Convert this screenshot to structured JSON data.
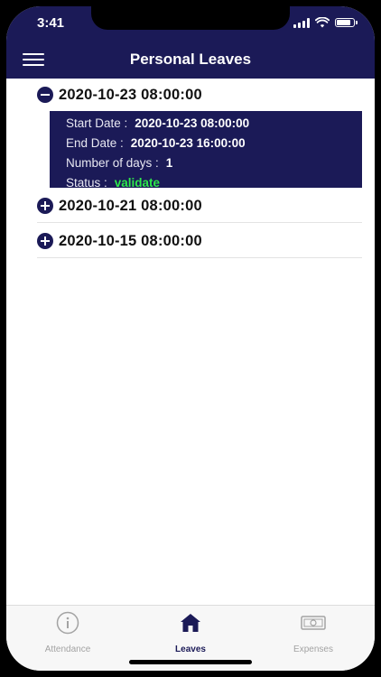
{
  "status_bar": {
    "time": "3:41"
  },
  "header": {
    "title": "Personal Leaves",
    "menu_icon": "hamburger-menu-icon"
  },
  "labels": {
    "start_date": "Start Date :",
    "end_date": "End Date :",
    "number_of_days": "Number of days :",
    "status": "Status :"
  },
  "leaves": [
    {
      "date": "2020-10-23 08:00:00",
      "expanded": true,
      "start_date": "2020-10-23 08:00:00",
      "end_date": "2020-10-23 16:00:00",
      "number_of_days": "1",
      "status": "validate"
    },
    {
      "date": "2020-10-21 08:00:00",
      "expanded": false
    },
    {
      "date": "2020-10-15 08:00:00",
      "expanded": false
    }
  ],
  "tabs": [
    {
      "label": "Attendance",
      "icon": "info-circle-icon",
      "active": false
    },
    {
      "label": "Leaves",
      "icon": "home-icon",
      "active": true
    },
    {
      "label": "Expenses",
      "icon": "banknote-icon",
      "active": false
    }
  ],
  "colors": {
    "primary": "#1b1a57",
    "status_validate": "#2ee84a",
    "tab_inactive": "#a3a3a3"
  }
}
